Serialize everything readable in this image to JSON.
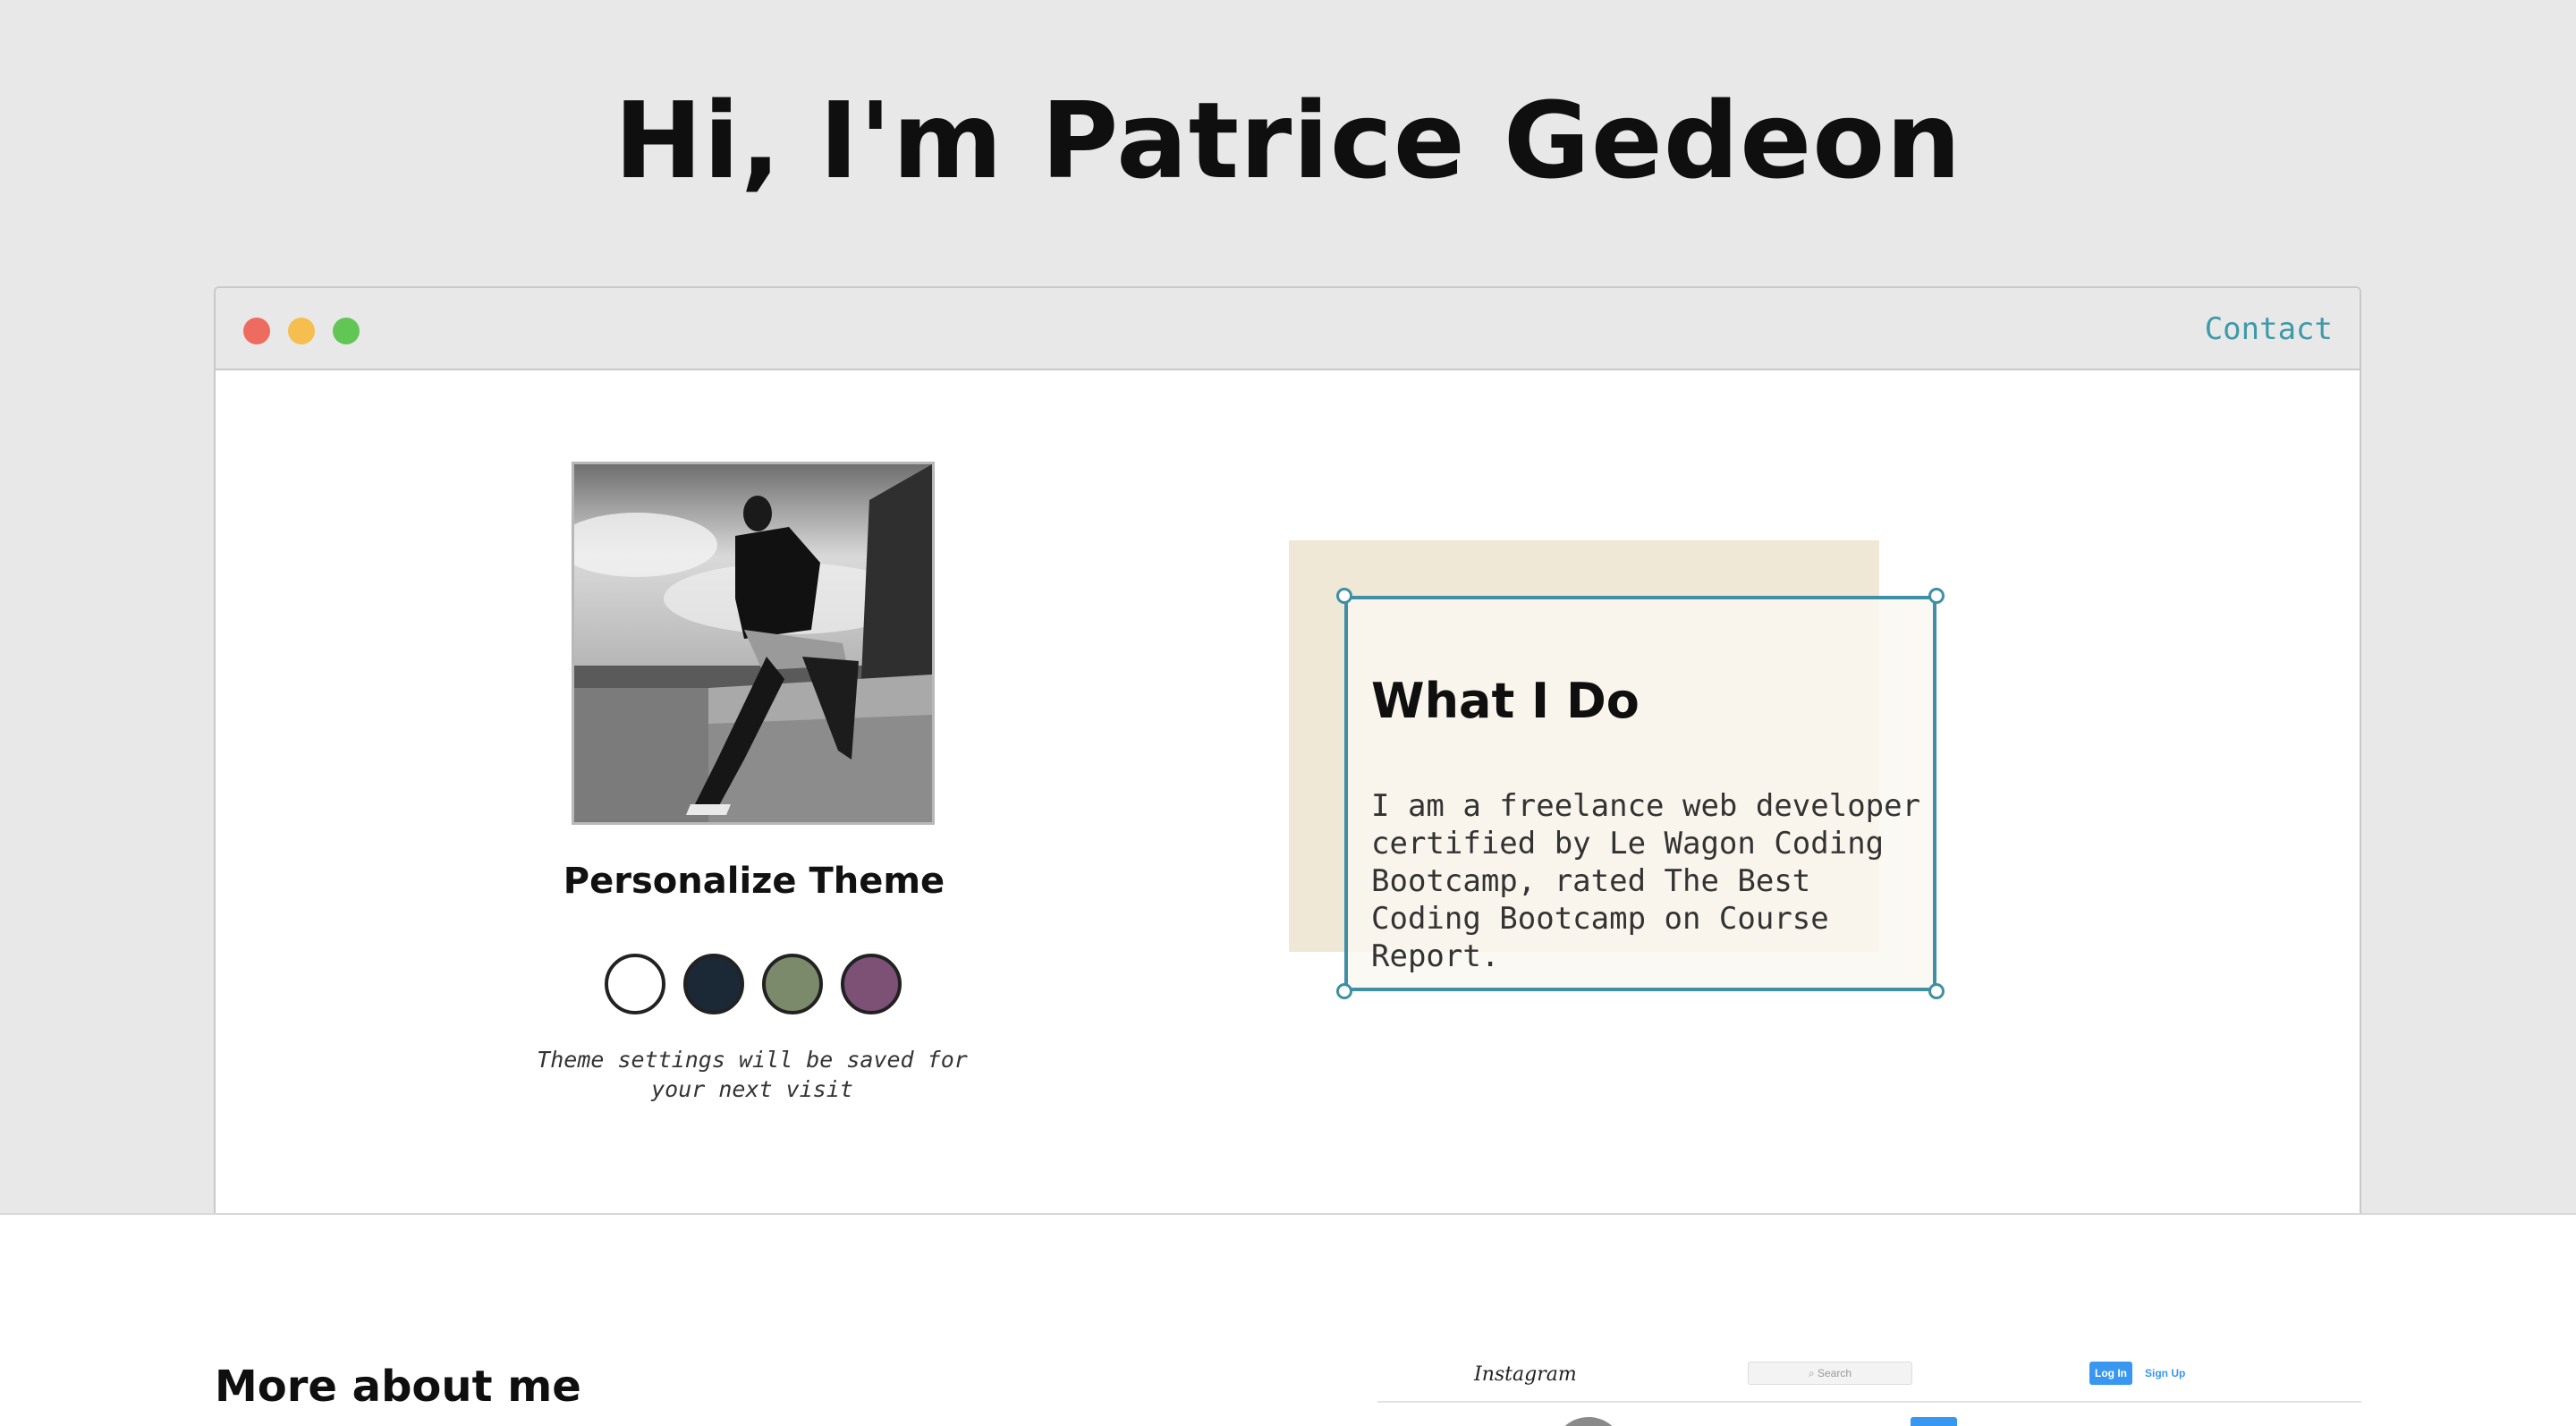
{
  "hero": {
    "title": "Hi, I'm Patrice Gedeon"
  },
  "window": {
    "controls": [
      "close",
      "minimize",
      "maximize"
    ],
    "nav": {
      "contact_label": "Contact"
    }
  },
  "profile": {
    "photo_icon": "profile-photo",
    "theme_title": "Personalize Theme",
    "swatches": [
      {
        "name": "white",
        "color": "#ffffff"
      },
      {
        "name": "navy",
        "color": "#1b2836"
      },
      {
        "name": "sage",
        "color": "#7b8a6b"
      },
      {
        "name": "plum",
        "color": "#7d5075"
      }
    ],
    "theme_note": "Theme settings will be saved for your next visit"
  },
  "what_i_do": {
    "title": "What I Do",
    "text": "I am a freelance web developer certified by Le Wagon Coding Bootcamp, rated The Best Coding Bootcamp on Course Report."
  },
  "more": {
    "title": "More about me",
    "instagram": {
      "logo": "Instagram",
      "search_placeholder": "⌕ Search",
      "login_label": "Log In",
      "signup_label": "Sign Up"
    }
  },
  "colors": {
    "accent": "#3f9aa8",
    "frame_border": "#3f8fa5",
    "card_back": "#f0e8d6"
  }
}
